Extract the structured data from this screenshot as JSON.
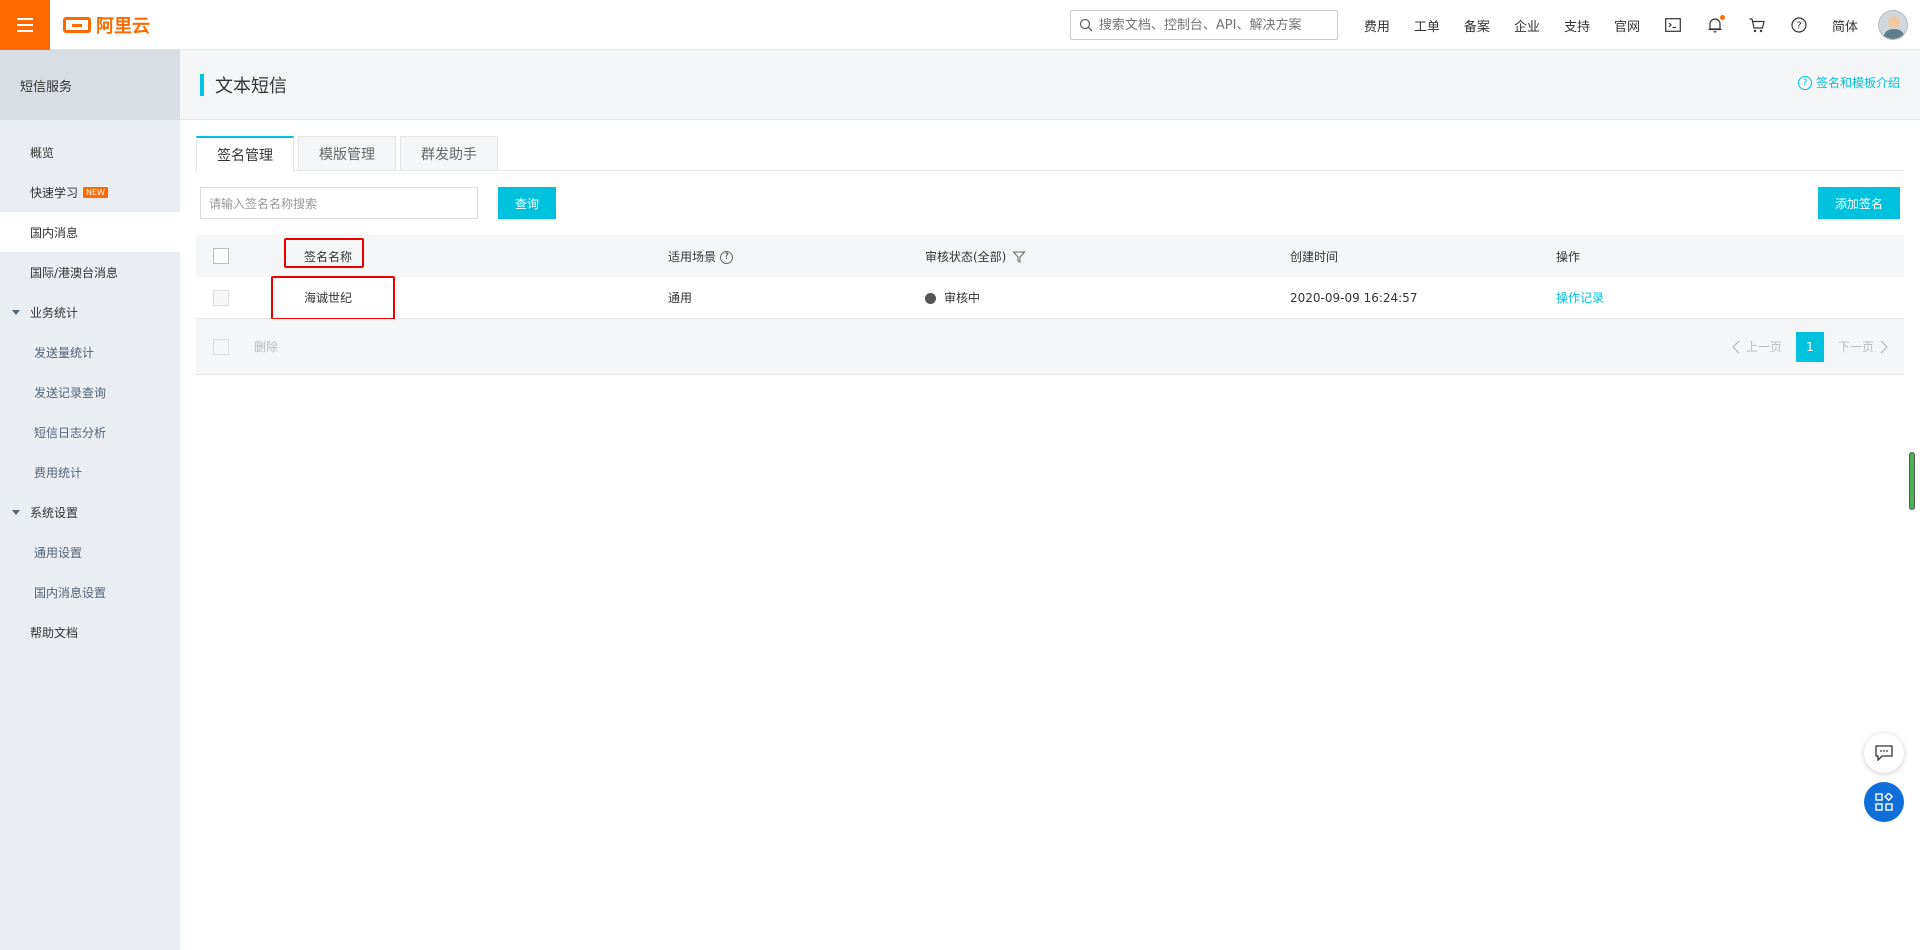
{
  "topbar": {
    "logo_text": "阿里云",
    "search_placeholder": "搜索文档、控制台、API、解决方案",
    "links": [
      "费用",
      "工单",
      "备案",
      "企业",
      "支持",
      "官网"
    ],
    "language": "简体"
  },
  "sidebar": {
    "title": "短信服务",
    "items": {
      "overview": "概览",
      "quickstart": "快速学习",
      "quickstart_badge": "NEW",
      "domestic": "国内消息",
      "international": "国际/港澳台消息",
      "stats_group": "业务统计",
      "send_stats": "发送量统计",
      "record_query": "发送记录查询",
      "log_analysis": "短信日志分析",
      "cost_stats": "费用统计",
      "settings_group": "系统设置",
      "general_settings": "通用设置",
      "domestic_settings": "国内消息设置",
      "help_docs": "帮助文档"
    }
  },
  "main": {
    "page_title": "文本短信",
    "intro_link": "签名和模板介绍",
    "tabs": [
      "签名管理",
      "模版管理",
      "群发助手"
    ],
    "search_placeholder": "请输入签名名称搜索",
    "query_button": "查询",
    "add_button": "添加签名",
    "table": {
      "headers": {
        "name": "签名名称",
        "scene": "适用场景",
        "status": "审核状态(全部)",
        "created": "创建时间",
        "actions": "操作"
      },
      "rows": [
        {
          "name": "海诚世纪",
          "scene": "通用",
          "status": "审核中",
          "created": "2020-09-09 16:24:57",
          "action": "操作记录"
        }
      ],
      "footer": {
        "delete": "删除",
        "prev": "上一页",
        "page": "1",
        "next": "下一页"
      }
    }
  },
  "colors": {
    "brand": "#ff6a00",
    "accent": "#00c1de",
    "highlight": "#ee0000"
  }
}
